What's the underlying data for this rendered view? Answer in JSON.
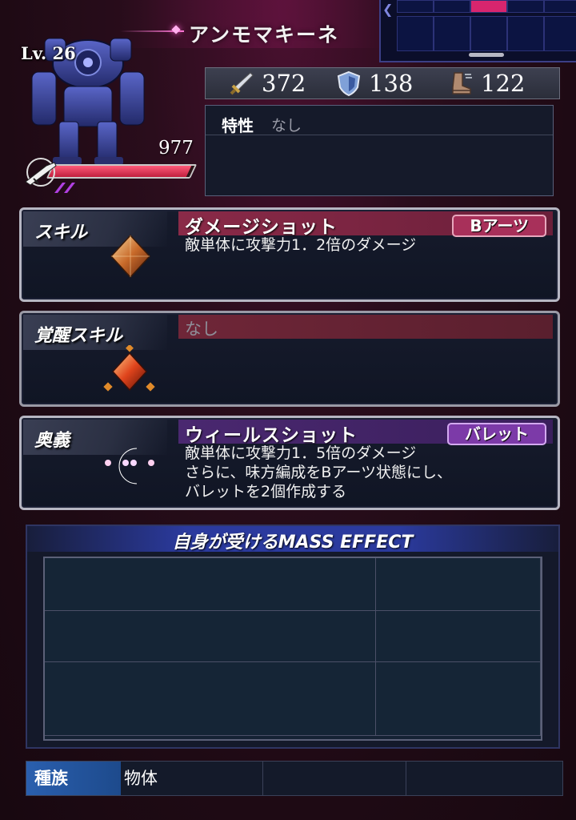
{
  "unit": {
    "name": "アンモマキーネ",
    "level": "Lv. 26",
    "hp": "977",
    "hp_fill_fraction": 0.98
  },
  "stats": {
    "attack": "372",
    "defense": "138",
    "speed": "122",
    "attack_icon": "sword-icon",
    "defense_icon": "shield-icon",
    "speed_icon": "boot-icon"
  },
  "trait": {
    "label": "特性",
    "value": "なし"
  },
  "skill": {
    "label": "スキル",
    "title": "ダメージショット",
    "tag": "Bアーツ",
    "description": "敵単体に攻撃力1．2倍のダメージ",
    "icon": "gem-icon"
  },
  "awakening": {
    "label": "覚醒スキル",
    "title": "なし",
    "icon": "awakened-gem-icon"
  },
  "ougi": {
    "label": "奥義",
    "title": "ウィールスショット",
    "tag": "バレット",
    "description": "敵単体に攻撃力1．5倍のダメージ\nさらに、味方編成をBアーツ状態にし、\nバレットを2個作成する",
    "icon": "rainbow-moon-icon"
  },
  "mass_effect": {
    "title": "自身が受けるMASS EFFECT"
  },
  "species": {
    "label": "種族",
    "value": "物体"
  },
  "colors": {
    "background": "#1e0a14",
    "skill_bar": "#8a2a48",
    "ougi_bar": "#4a2870",
    "mass_header": "#2b3a9e",
    "species_label": "#2a5fae"
  }
}
